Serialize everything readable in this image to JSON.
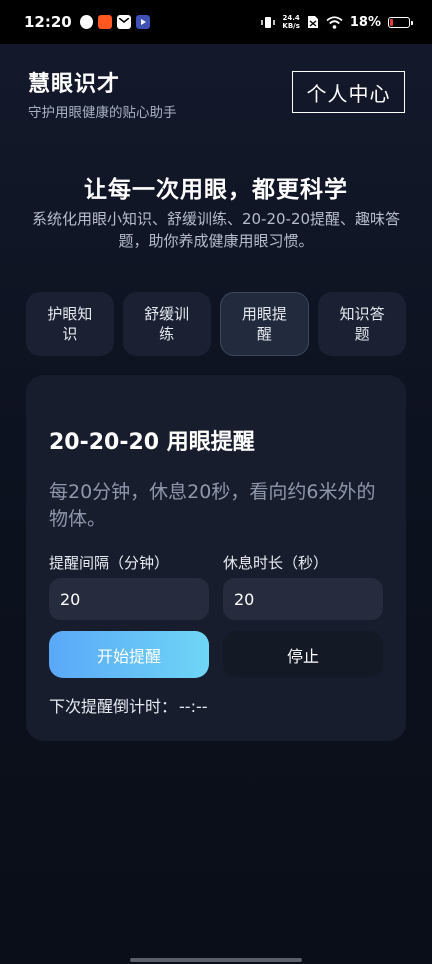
{
  "status_bar": {
    "time": "12:20",
    "net_speed_value": "24.4",
    "net_speed_unit": "KB/s",
    "battery_percent": "18%",
    "battery_level": 0.18,
    "battery_color": "#e53935"
  },
  "header": {
    "title": "慧眼识才",
    "subtitle": "守护用眼健康的贴心助手",
    "profile_button": "个人中心"
  },
  "hero": {
    "title": "让每一次用眼，都更科学",
    "description": "系统化用眼小知识、舒缓训练、20-20-20提醒、趣味答题，助你养成健康用眼习惯。"
  },
  "tabs": [
    {
      "label": "护眼知识",
      "active": false
    },
    {
      "label": "舒缓训练",
      "active": false
    },
    {
      "label": "用眼提醒",
      "active": true
    },
    {
      "label": "知识答题",
      "active": false
    }
  ],
  "reminder_card": {
    "title": "20-20-20 用眼提醒",
    "description": "每20分钟，休息20秒，看向约6米外的物体。",
    "interval_label": "提醒间隔（分钟）",
    "interval_value": "20",
    "rest_label": "休息时长（秒）",
    "rest_value": "20",
    "start_button": "开始提醒",
    "stop_button": "停止",
    "countdown_label": "下次提醒倒计时：",
    "countdown_value": "--:--"
  },
  "colors": {
    "accent_gradient_start": "#5aa8f8",
    "accent_gradient_end": "#6fd6f6",
    "background": "#0f1424",
    "card": "#181d2d"
  }
}
